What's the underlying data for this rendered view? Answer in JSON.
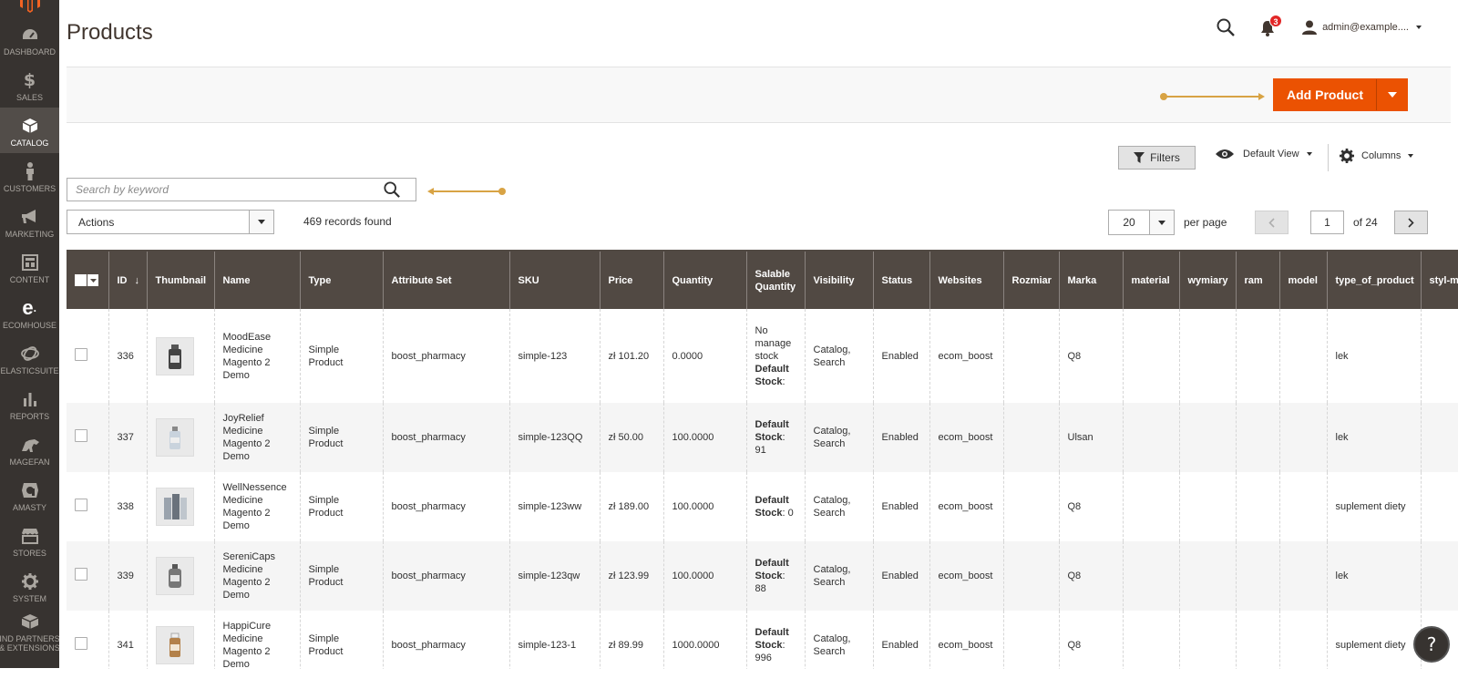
{
  "sidebar": {
    "items": [
      {
        "label": "DASHBOARD",
        "icon": "dashboard-icon"
      },
      {
        "label": "SALES",
        "icon": "dollar-icon"
      },
      {
        "label": "CATALOG",
        "icon": "cube-icon"
      },
      {
        "label": "CUSTOMERS",
        "icon": "person-icon"
      },
      {
        "label": "MARKETING",
        "icon": "megaphone-icon"
      },
      {
        "label": "CONTENT",
        "icon": "layout-icon"
      },
      {
        "label": "ECOMHOUSE",
        "icon": "ecomhouse-logo-icon"
      },
      {
        "label": "ELASTICSUITE",
        "icon": "elasticsuite-icon"
      },
      {
        "label": "REPORTS",
        "icon": "bar-chart-icon"
      },
      {
        "label": "MAGEFAN",
        "icon": "magefan-icon"
      },
      {
        "label": "AMASTY",
        "icon": "amasty-icon"
      },
      {
        "label": "STORES",
        "icon": "store-icon"
      },
      {
        "label": "SYSTEM",
        "icon": "gear-icon"
      },
      {
        "label_line1": "IND PARTNERS",
        "label_line2": "& EXTENSIONS",
        "icon": "box-icon"
      }
    ]
  },
  "header": {
    "title": "Products",
    "notifications_count": "3",
    "user": "admin@example...."
  },
  "actions": {
    "add_product": "Add Product"
  },
  "toolbar": {
    "filters": "Filters",
    "view": "Default View",
    "columns": "Columns",
    "search_placeholder": "Search by keyword",
    "mass_actions": "Actions",
    "records_found": "469 records found",
    "per_page_value": "20",
    "per_page_label": "per page",
    "page_current": "1",
    "page_total": "of 24"
  },
  "colors": {
    "accent": "#eb5202",
    "sidebar_bg": "#373330",
    "header_bg": "#514943",
    "annotation": "#d8a344"
  },
  "table": {
    "columns": [
      "ID",
      "Thumbnail",
      "Name",
      "Type",
      "Attribute Set",
      "SKU",
      "Price",
      "Quantity",
      "Salable Quantity",
      "Visibility",
      "Status",
      "Websites",
      "Rozmiar",
      "Marka",
      "material",
      "wymiary",
      "ram",
      "model",
      "type_of_product",
      "styl-multis"
    ],
    "rows": [
      {
        "id": "336",
        "name": "MoodEase Medicine Magento 2 Demo",
        "type": "Simple Product",
        "attr_set": "boost_pharmacy",
        "sku": "simple-123",
        "price": "zł 101.20",
        "qty": "0.0000",
        "salable_pre": "No manage stock",
        "salable_label": "Default Stock",
        "salable_val": ":",
        "visibility": "Catalog, Search",
        "status": "Enabled",
        "websites": "ecom_boost",
        "rozmiar": "",
        "marka": "Q8",
        "material": "",
        "wymiary": "",
        "ram": "",
        "model": "",
        "type_of_product": "lek"
      },
      {
        "id": "337",
        "name": "JoyRelief Medicine Magento 2 Demo",
        "type": "Simple Product",
        "attr_set": "boost_pharmacy",
        "sku": "simple-123QQ",
        "price": "zł 50.00",
        "qty": "100.0000",
        "salable_pre": "",
        "salable_label": "Default Stock",
        "salable_val": ": 91",
        "visibility": "Catalog, Search",
        "status": "Enabled",
        "websites": "ecom_boost",
        "rozmiar": "",
        "marka": "Ulsan",
        "material": "",
        "wymiary": "",
        "ram": "",
        "model": "",
        "type_of_product": "lek"
      },
      {
        "id": "338",
        "name": "WellNessence Medicine Magento 2 Demo",
        "type": "Simple Product",
        "attr_set": "boost_pharmacy",
        "sku": "simple-123ww",
        "price": "zł 189.00",
        "qty": "100.0000",
        "salable_pre": "",
        "salable_label": "Default Stock",
        "salable_val": ": 0",
        "visibility": "Catalog, Search",
        "status": "Enabled",
        "websites": "ecom_boost",
        "rozmiar": "",
        "marka": "Q8",
        "material": "",
        "wymiary": "",
        "ram": "",
        "model": "",
        "type_of_product": "suplement diety"
      },
      {
        "id": "339",
        "name": "SereniCaps Medicine Magento 2 Demo",
        "type": "Simple Product",
        "attr_set": "boost_pharmacy",
        "sku": "simple-123qw",
        "price": "zł 123.99",
        "qty": "100.0000",
        "salable_pre": "",
        "salable_label": "Default Stock",
        "salable_val": ": 88",
        "visibility": "Catalog, Search",
        "status": "Enabled",
        "websites": "ecom_boost",
        "rozmiar": "",
        "marka": "Q8",
        "material": "",
        "wymiary": "",
        "ram": "",
        "model": "",
        "type_of_product": "lek"
      },
      {
        "id": "341",
        "name": "HappiCure Medicine Magento 2 Demo",
        "type": "Simple Product",
        "attr_set": "boost_pharmacy",
        "sku": "simple-123-1",
        "price": "zł 89.99",
        "qty": "1000.0000",
        "salable_pre": "",
        "salable_label": "Default Stock",
        "salable_val": ": 996",
        "visibility": "Catalog, Search",
        "status": "Enabled",
        "websites": "ecom_boost",
        "rozmiar": "",
        "marka": "Q8",
        "material": "",
        "wymiary": "",
        "ram": "",
        "model": "",
        "type_of_product": "suplement diety"
      }
    ]
  },
  "help": "?"
}
